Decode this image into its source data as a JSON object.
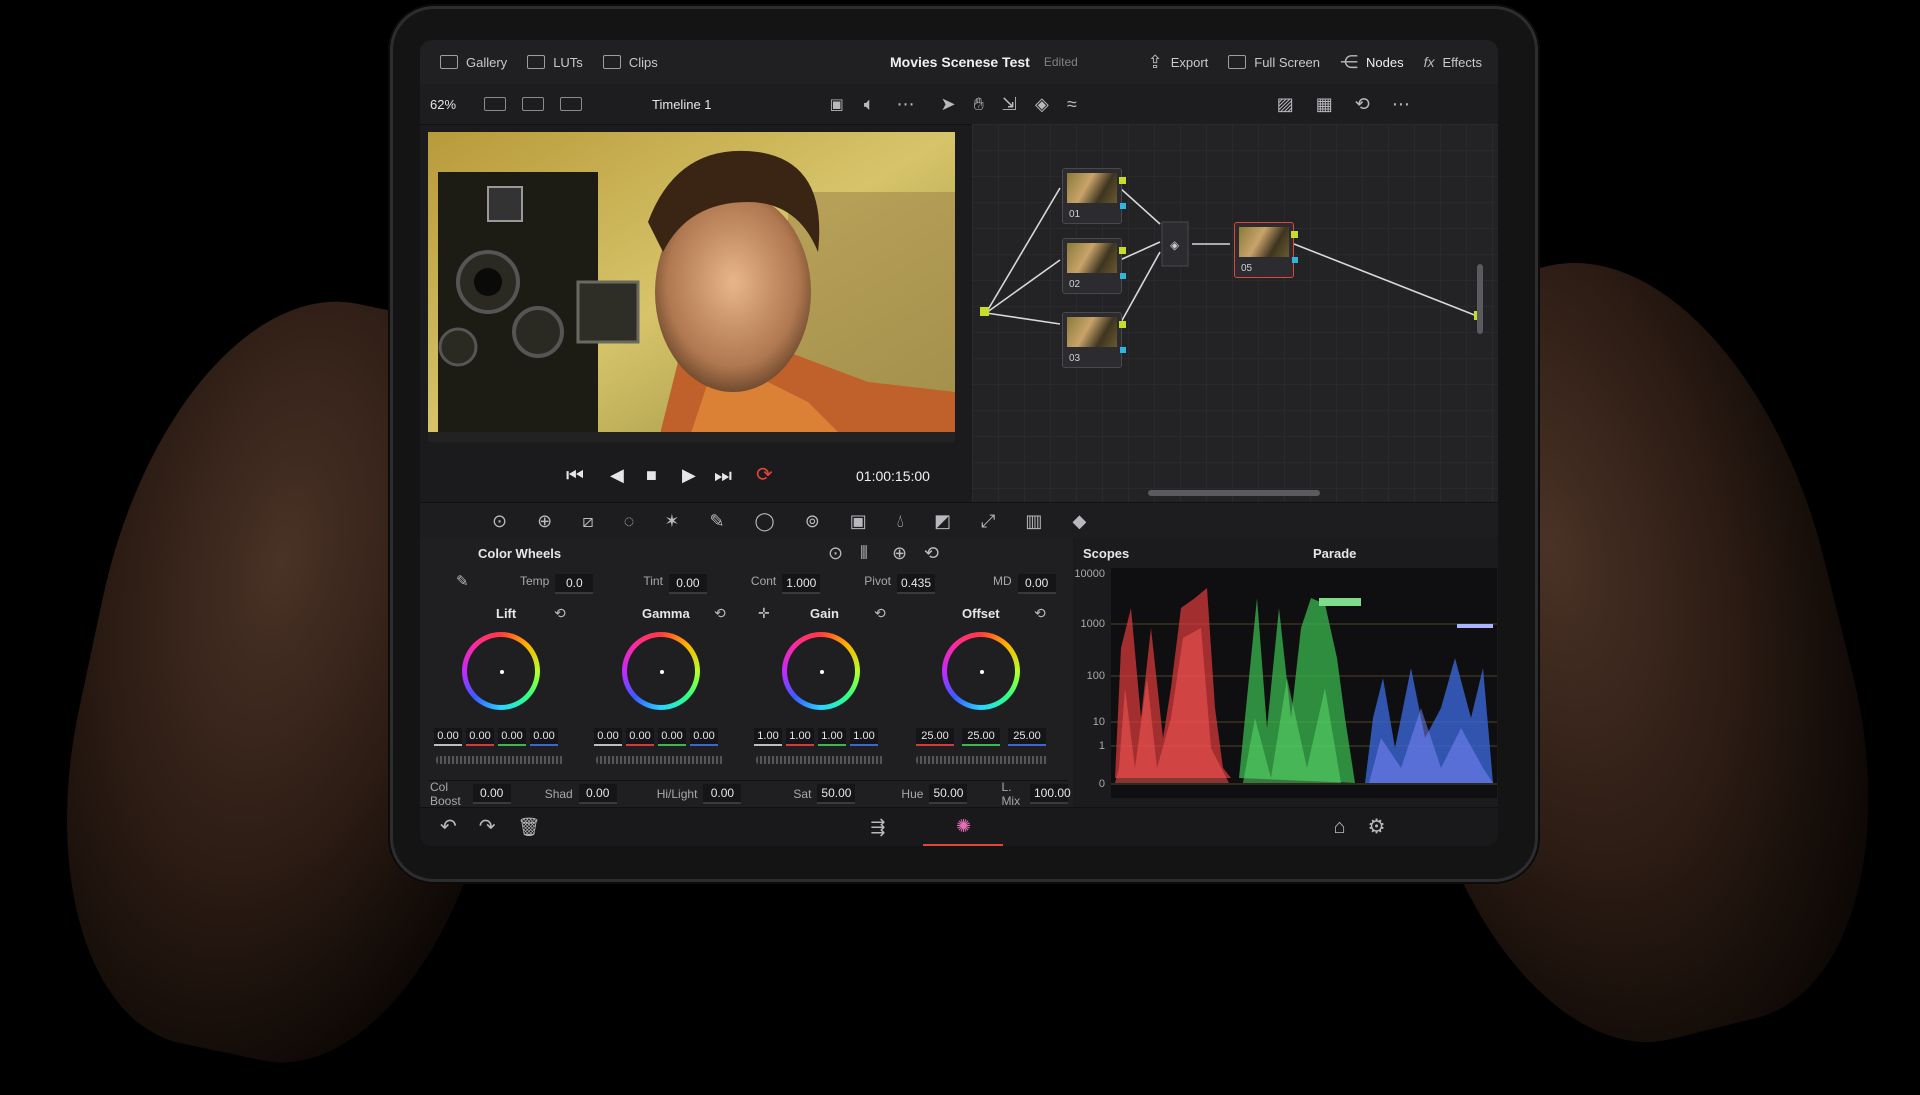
{
  "header": {
    "gallery": "Gallery",
    "luts": "LUTs",
    "clips": "Clips",
    "project_title": "Movies Scenese Test",
    "status": "Edited",
    "export": "Export",
    "full_screen": "Full Screen",
    "nodes": "Nodes",
    "effects": "Effects"
  },
  "viewer_bar": {
    "zoom": "62%",
    "timeline": "Timeline 1"
  },
  "transport": {
    "timecode": "01:00:15:00"
  },
  "node_graph": {
    "nodes": [
      "01",
      "02",
      "03",
      "05"
    ]
  },
  "color_wheels": {
    "title": "Color Wheels",
    "top_params": [
      {
        "label": "Temp",
        "value": "0.0"
      },
      {
        "label": "Tint",
        "value": "0.00"
      },
      {
        "label": "Cont",
        "value": "1.000"
      },
      {
        "label": "Pivot",
        "value": "0.435"
      },
      {
        "label": "MD",
        "value": "0.00"
      }
    ],
    "wheels": [
      {
        "name": "Lift",
        "values": [
          "0.00",
          "0.00",
          "0.00",
          "0.00"
        ]
      },
      {
        "name": "Gamma",
        "values": [
          "0.00",
          "0.00",
          "0.00",
          "0.00"
        ]
      },
      {
        "name": "Gain",
        "values": [
          "1.00",
          "1.00",
          "1.00",
          "1.00"
        ]
      },
      {
        "name": "Offset",
        "values": [
          "25.00",
          "25.00",
          "25.00"
        ]
      }
    ],
    "bottom_params": [
      {
        "label": "Col Boost",
        "value": "0.00"
      },
      {
        "label": "Shad",
        "value": "0.00"
      },
      {
        "label": "Hi/Light",
        "value": "0.00"
      },
      {
        "label": "Sat",
        "value": "50.00"
      },
      {
        "label": "Hue",
        "value": "50.00"
      },
      {
        "label": "L. Mix",
        "value": "100.00"
      }
    ]
  },
  "scopes": {
    "title": "Scopes",
    "mode": "Parade",
    "y_labels": [
      "10000",
      "1000",
      "100",
      "10",
      "1",
      "0"
    ]
  },
  "colors": {
    "accent_red": "#e0453a",
    "node_green": "#c8dc2c",
    "node_blue": "#2fb6e0"
  }
}
